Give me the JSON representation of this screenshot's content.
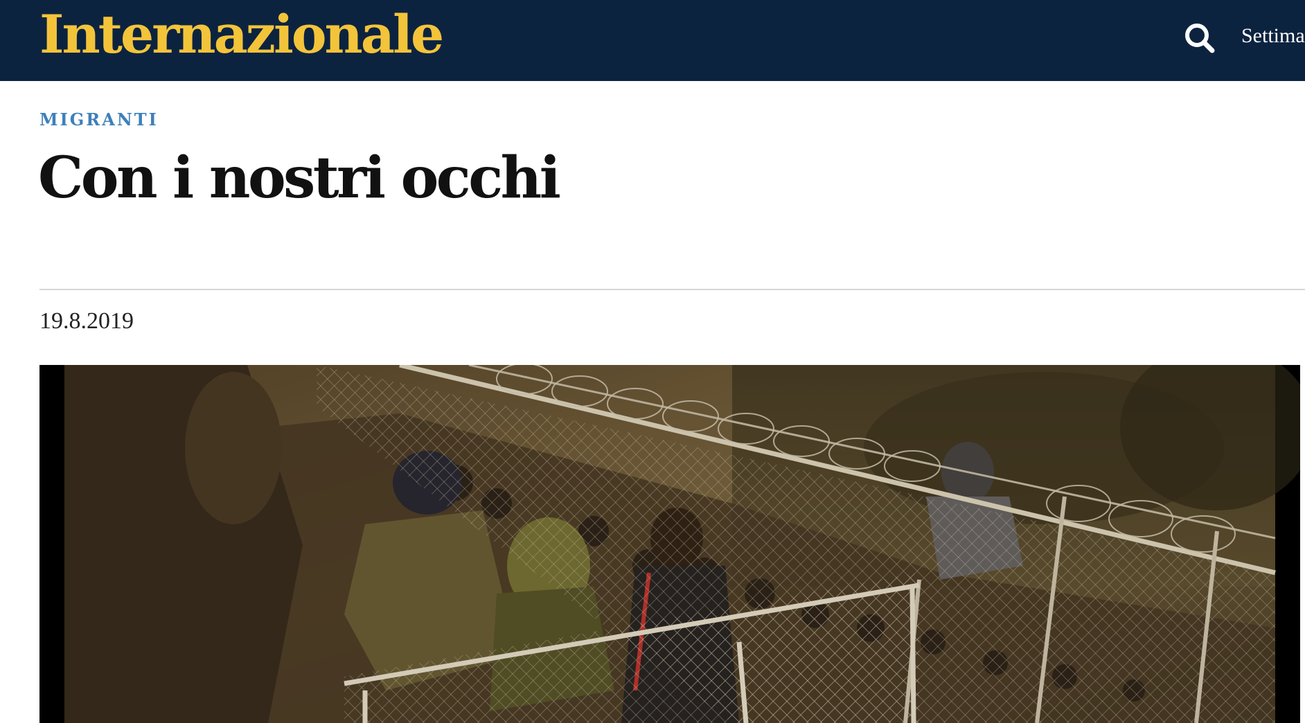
{
  "header": {
    "logo_text": "Internazionale",
    "nav_link_label": "Settima",
    "search_icon": "search-icon"
  },
  "article": {
    "category": "MIGRANTI",
    "title": "Con i nostri occhi",
    "date": "19.8.2019"
  },
  "hero_image": {
    "subject": "photo"
  },
  "colors": {
    "header_background": "#0c2340",
    "logo": "#f3c43a",
    "category": "#3e80bb",
    "text": "#111111"
  }
}
